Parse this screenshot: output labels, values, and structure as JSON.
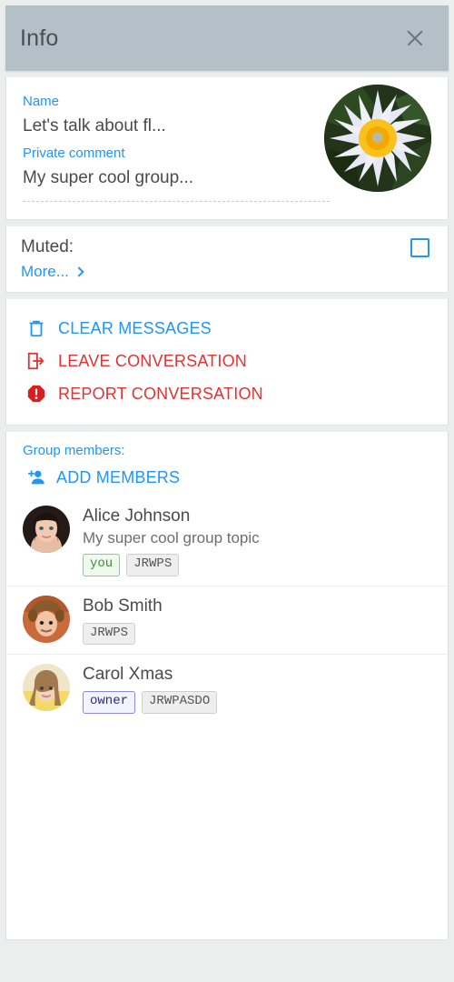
{
  "header": {
    "title": "Info",
    "close_icon": "close-icon",
    "background_color": "#b3c0c8"
  },
  "info": {
    "name_label": "Name",
    "name_value": "Let's talk about fl...",
    "comment_label": "Private comment",
    "comment_value": "My super cool group...",
    "avatar_icon": "group-avatar-flower"
  },
  "muted": {
    "label": "Muted:",
    "checked": false,
    "more_label": "More...",
    "chevron_icon": "chevron-right-icon",
    "accent_color": "#2196f3"
  },
  "actions": [
    {
      "label": "CLEAR MESSAGES",
      "icon": "trash-icon",
      "color": "#2196f3",
      "tone": "blue"
    },
    {
      "label": "LEAVE CONVERSATION",
      "icon": "exit-arrow-icon",
      "color": "#e03434",
      "tone": "red"
    },
    {
      "label": "REPORT CONVERSATION",
      "icon": "report-octagon-icon",
      "color": "#e03434",
      "tone": "red"
    }
  ],
  "members": {
    "label": "Group members:",
    "add_label": "ADD MEMBERS",
    "add_icon": "add-person-icon",
    "list": [
      {
        "name": "Alice Johnson",
        "topic": "My super cool group topic",
        "avatar_icon": "avatar-alice",
        "badges": [
          {
            "text": "you",
            "style": "you"
          },
          {
            "text": "JRWPS",
            "style": "gray"
          }
        ]
      },
      {
        "name": "Bob Smith",
        "topic": "",
        "avatar_icon": "avatar-bob",
        "badges": [
          {
            "text": "JRWPS",
            "style": "gray"
          }
        ]
      },
      {
        "name": "Carol Xmas",
        "topic": "",
        "avatar_icon": "avatar-carol",
        "badges": [
          {
            "text": "owner",
            "style": "owner"
          },
          {
            "text": "JRWPASDO",
            "style": "gray"
          }
        ]
      }
    ]
  }
}
